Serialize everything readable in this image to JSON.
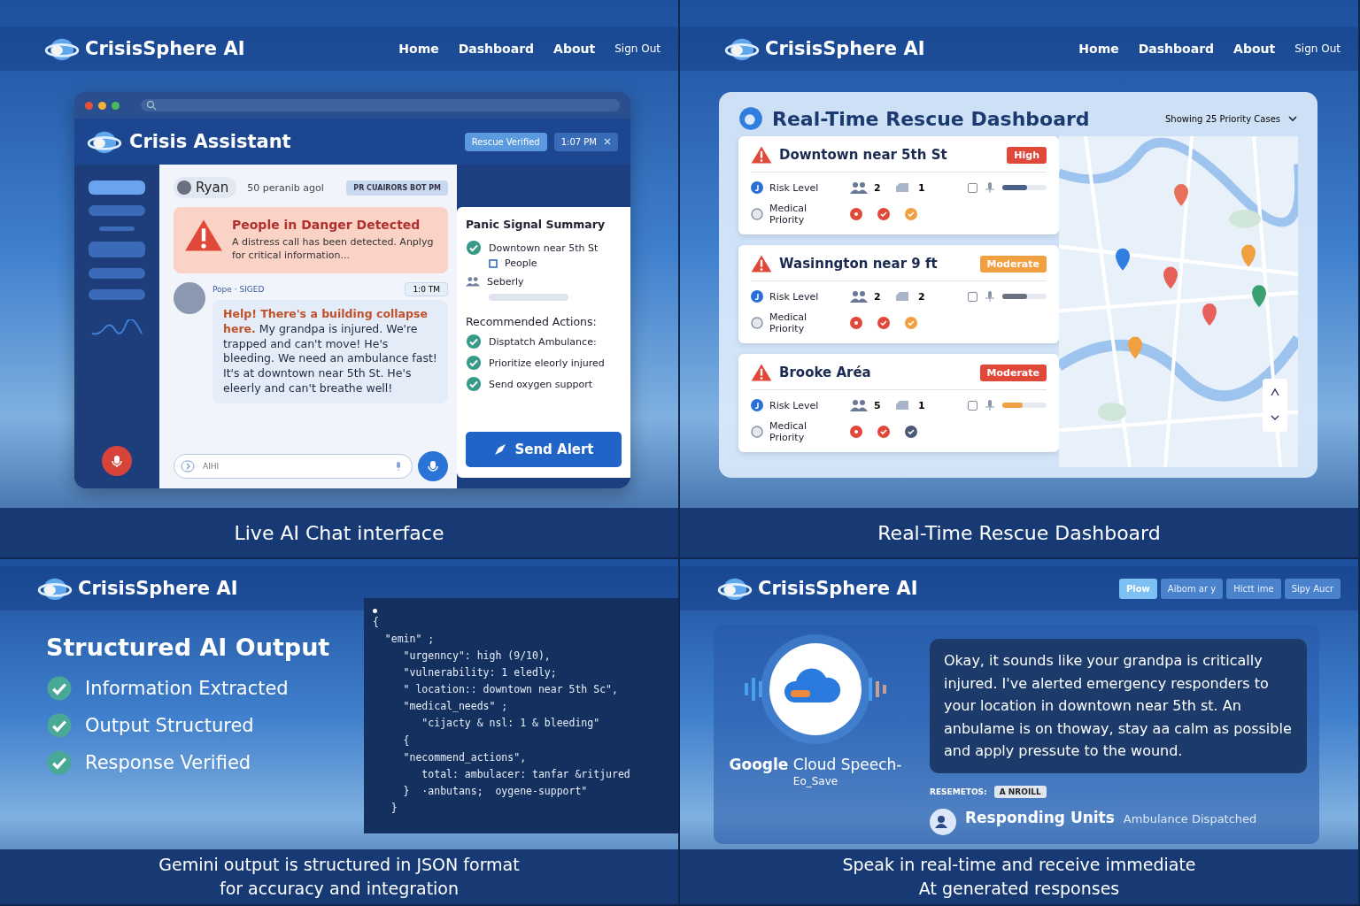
{
  "chat_screen": {
    "brand": "CrisisSphere AI",
    "nav": [
      "Home",
      "Dashboard",
      "About",
      "Sign Out"
    ],
    "window": {
      "title": "Crisis Assistant",
      "status": "Rescue Verified",
      "time": "1:07 PM"
    },
    "sidebar": [
      {
        "selected": true
      },
      {
        "selected": false
      },
      {
        "selected": false
      },
      {
        "selected": false
      },
      {
        "selected": false
      },
      {
        "selected": false
      }
    ],
    "user": {
      "name": "Ryan",
      "ago": "50 peranib agol"
    },
    "stamp": "PR CUAIRORS BOT PM",
    "alert": {
      "title": "People in Danger Detected",
      "text": "A distress call has been detected. Anplyg for critical information..."
    },
    "message": {
      "sender": "Pope · SIGED",
      "time": "1:0 TM",
      "highlight": "Help! There's a building collapse here.",
      "text": " My grandpa is injured. We're trapped and can't move! He's bleeding. We need an ambulance fast! It's at downtown near 5th St. He's eleerly and can't breathe well!"
    },
    "input": {
      "placeholder": "AIHI"
    },
    "summary": {
      "title": "Panic Signal Summary",
      "location": "Downtown near 5th St",
      "people": "People",
      "group": "Seberly",
      "actions_title": "Recommended Actions:",
      "actions": [
        "Disptatch Ambulance:",
        "Prioritize eleorly injured",
        "Send oxygen support"
      ],
      "button": "Send Alert"
    },
    "caption": "Live AI Chat interface"
  },
  "dashboard_screen": {
    "brand": "CrisisSphere AI",
    "nav": [
      "Home",
      "Dashboard",
      "About",
      "Sign Out"
    ],
    "title": "Real-Time Rescue Dashboard",
    "filter": "Showing 25 Priority Cases",
    "cases": [
      {
        "title": "Downtown near 5th St",
        "badge": {
          "label": "High",
          "color": "#e0483a"
        },
        "risk_label": "Risk Level",
        "people": "2",
        "units": "1",
        "checked": false,
        "risk_bar": {
          "level": 0.55,
          "color": "#4a6088"
        },
        "medical_label": "Medical Priority",
        "markers": [
          {
            "kind": "dot",
            "color": "#e0483a"
          },
          {
            "kind": "check",
            "color": "#e0483a"
          },
          {
            "kind": "check",
            "color": "#f0a040"
          }
        ]
      },
      {
        "title": "Wasinngton near 9 ft",
        "badge": {
          "label": "Moderate",
          "color": "#f0a040"
        },
        "risk_label": "Risk Level",
        "people": "2",
        "units": "2",
        "checked": false,
        "risk_bar": {
          "level": 0.55,
          "color": "#6a7080"
        },
        "medical_label": "Medical Priority",
        "markers": [
          {
            "kind": "dot",
            "color": "#e0483a"
          },
          {
            "kind": "check",
            "color": "#e0483a"
          },
          {
            "kind": "check",
            "color": "#f0a040"
          }
        ]
      },
      {
        "title": "Brooke Aréa",
        "badge": {
          "label": "Moderate",
          "color": "#e0483a"
        },
        "risk_label": "Risk Level",
        "people": "5",
        "units": "1",
        "checked": false,
        "risk_bar": {
          "level": 0.45,
          "color": "#f0a040"
        },
        "medical_label": "Medical Priority",
        "markers": [
          {
            "kind": "dot",
            "color": "#e0483a"
          },
          {
            "kind": "check",
            "color": "#e0483a"
          },
          {
            "kind": "check",
            "color": "#4a5a78"
          }
        ]
      }
    ],
    "caption": "Real-Time Rescue Dashboard"
  },
  "structured_screen": {
    "brand": "CrisisSphere AI",
    "title": "Structured AI Output",
    "checks": [
      "Information Extracted",
      "Output Structured",
      "Response Verified"
    ],
    "code": [
      "{",
      "  \"emin\" ;",
      "     \"urgenncy\": high (9/10),",
      "     \"vulnerability: 1 eledly;",
      "     \" location:: downtown near 5th Sc\",",
      "     \"medical_needs\" ;",
      "        \"cijacty & nsl: 1 & bleeding\"",
      "     {",
      "     \"necommend_actions\",",
      "        total: ambulacer: tanfar &ritjured",
      "     }  ·anbutans;  oygene-support\"",
      "   }"
    ],
    "caption": [
      "Gemini output is structured in JSON format",
      "for accuracy and integration"
    ]
  },
  "speech_screen": {
    "brand": "CrisisSphere AI",
    "tabs": [
      {
        "label": "Plow",
        "selected": true
      },
      {
        "label": "Aibom ar y",
        "selected": false
      },
      {
        "label": "Hictt ime",
        "selected": false
      },
      {
        "label": "Sipy Aucr",
        "selected": false
      }
    ],
    "service": "**Google** Cloud Speech-",
    "service_sub": "Eo_Save",
    "response": "Okay, it sounds like your grandpa is critically injured. I've alerted emergency responders to your location in downtown near 5th st. An anbulame is on thoway, stay aa calm as possible and apply pressute to the wound.",
    "meta_label": "RESEMETOS:",
    "meta_tag": "A NROILL",
    "units_title": "Responding Units",
    "units_status": "Ambulance Dispatched",
    "caption": [
      "Speak in real-time and receive immediate",
      "At generated responses"
    ]
  }
}
